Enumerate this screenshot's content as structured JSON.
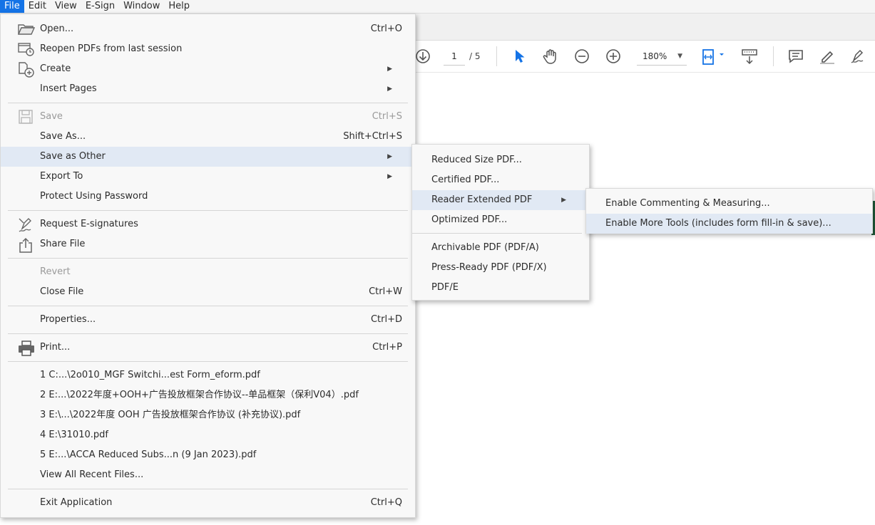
{
  "menubar": {
    "items": [
      "File",
      "Edit",
      "View",
      "E-Sign",
      "Window",
      "Help"
    ]
  },
  "toolbar": {
    "page_current": "1",
    "page_total": "/ 5",
    "zoom": "180%",
    "icons": [
      "page-down-icon",
      "select-arrow-icon",
      "hand-tool-icon",
      "zoom-out-icon",
      "zoom-in-icon",
      "fit-page-icon",
      "scroll-mode-icon",
      "comment-icon",
      "highlight-icon",
      "sign-icon"
    ],
    "accent": "#1473e6"
  },
  "file_menu": {
    "open": {
      "label": "Open...",
      "shortcut": "Ctrl+O"
    },
    "reopen": {
      "label": "Reopen PDFs from last session"
    },
    "create": {
      "label": "Create"
    },
    "insert_pages": {
      "label": "Insert Pages"
    },
    "save": {
      "label": "Save",
      "shortcut": "Ctrl+S"
    },
    "save_as": {
      "label": "Save As...",
      "shortcut": "Shift+Ctrl+S"
    },
    "save_as_other": {
      "label": "Save as Other"
    },
    "export_to": {
      "label": "Export To"
    },
    "protect": {
      "label": "Protect Using Password"
    },
    "request_esig": {
      "label": "Request E-signatures"
    },
    "share_file": {
      "label": "Share File"
    },
    "revert": {
      "label": "Revert"
    },
    "close_file": {
      "label": "Close File",
      "shortcut": "Ctrl+W"
    },
    "properties": {
      "label": "Properties...",
      "shortcut": "Ctrl+D"
    },
    "print": {
      "label": "Print...",
      "shortcut": "Ctrl+P"
    },
    "recent": [
      "1 C:...\\2o010_MGF Switchi...est Form_eform.pdf",
      "2 E:...\\2022年度+OOH+广告投放框架合作协议--单品框架（保利V04）.pdf",
      "3 E:\\...\\2022年度 OOH 广告投放框架合作协议 (补充协议).pdf",
      "4 E:\\31010.pdf",
      "5 E:...\\ACCA Reduced Subs...n (9 Jan 2023).pdf"
    ],
    "view_all_recent": {
      "label": "View All Recent Files..."
    },
    "exit": {
      "label": "Exit Application",
      "shortcut": "Ctrl+Q"
    }
  },
  "save_as_other_menu": {
    "items": [
      "Reduced Size PDF...",
      "Certified PDF...",
      "Reader Extended PDF",
      "Optimized PDF...",
      "Archivable PDF (PDF/A)",
      "Press-Ready PDF (PDF/X)",
      "PDF/E"
    ]
  },
  "reader_extended_menu": {
    "items": [
      "Enable Commenting & Measuring...",
      "Enable More Tools (includes form fill-in & save)..."
    ]
  },
  "colors": {
    "highlight": "#e1e9f4",
    "menubar_active": "#1473e6",
    "disabled_text": "#9a9a9a"
  }
}
